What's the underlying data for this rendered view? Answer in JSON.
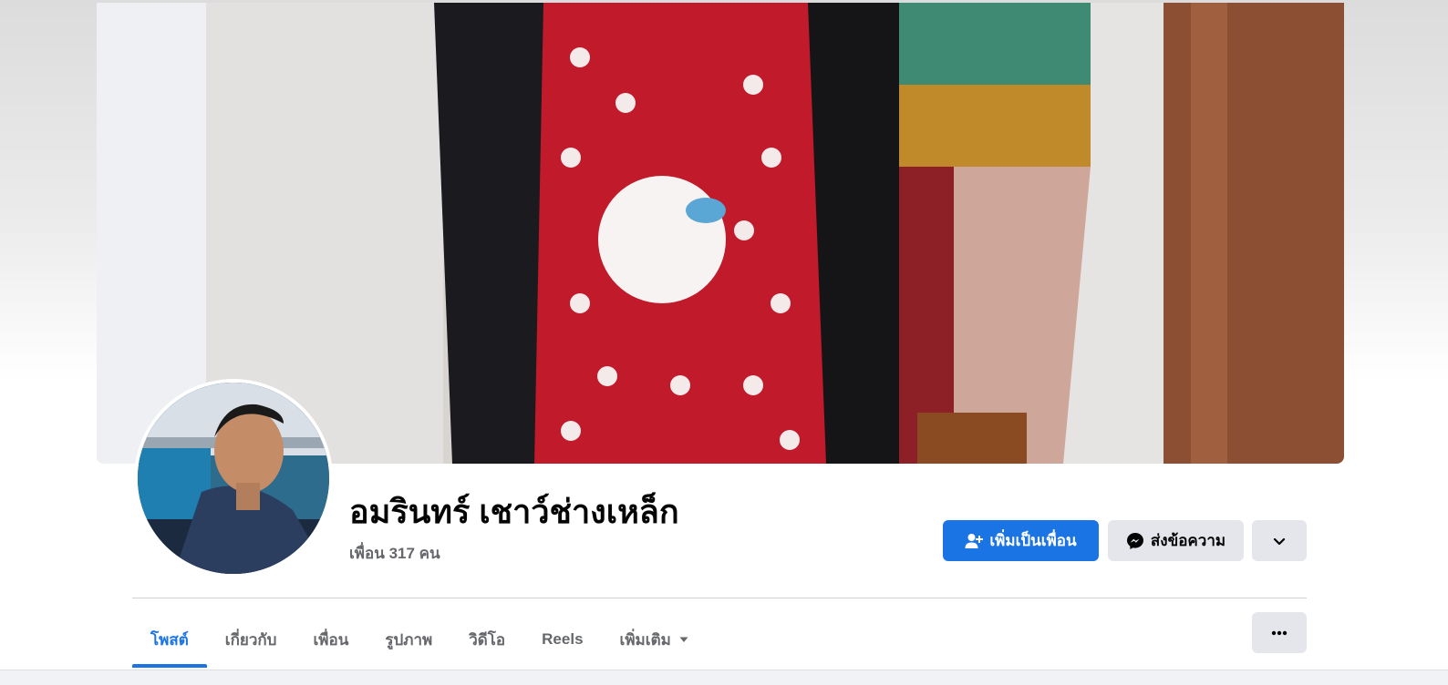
{
  "profile": {
    "name": "อมรินทร์ เชาว์ช่างเหล็ก",
    "friends_count": "เพื่อน 317 คน"
  },
  "actions": {
    "add_friend_label": "เพิ่มเป็นเพื่อน",
    "message_label": "ส่งข้อความ"
  },
  "tabs": [
    {
      "label": "โพสต์",
      "active": true
    },
    {
      "label": "เกี่ยวกับ",
      "active": false
    },
    {
      "label": "เพื่อน",
      "active": false
    },
    {
      "label": "รูปภาพ",
      "active": false
    },
    {
      "label": "วิดีโอ",
      "active": false
    },
    {
      "label": "Reels",
      "active": false
    },
    {
      "label": "เพิ่มเติม",
      "active": false
    }
  ],
  "icons": {
    "add_friend": "person-plus-icon",
    "message": "messenger-icon",
    "more_dropdown": "chevron-down-icon",
    "tab_more_caret": "caret-down-icon",
    "overflow": "ellipsis-icon"
  },
  "colors": {
    "accent": "#1b74e4",
    "secondary_button": "#e4e6eb",
    "text_primary": "#050505",
    "text_secondary": "#65676b"
  }
}
